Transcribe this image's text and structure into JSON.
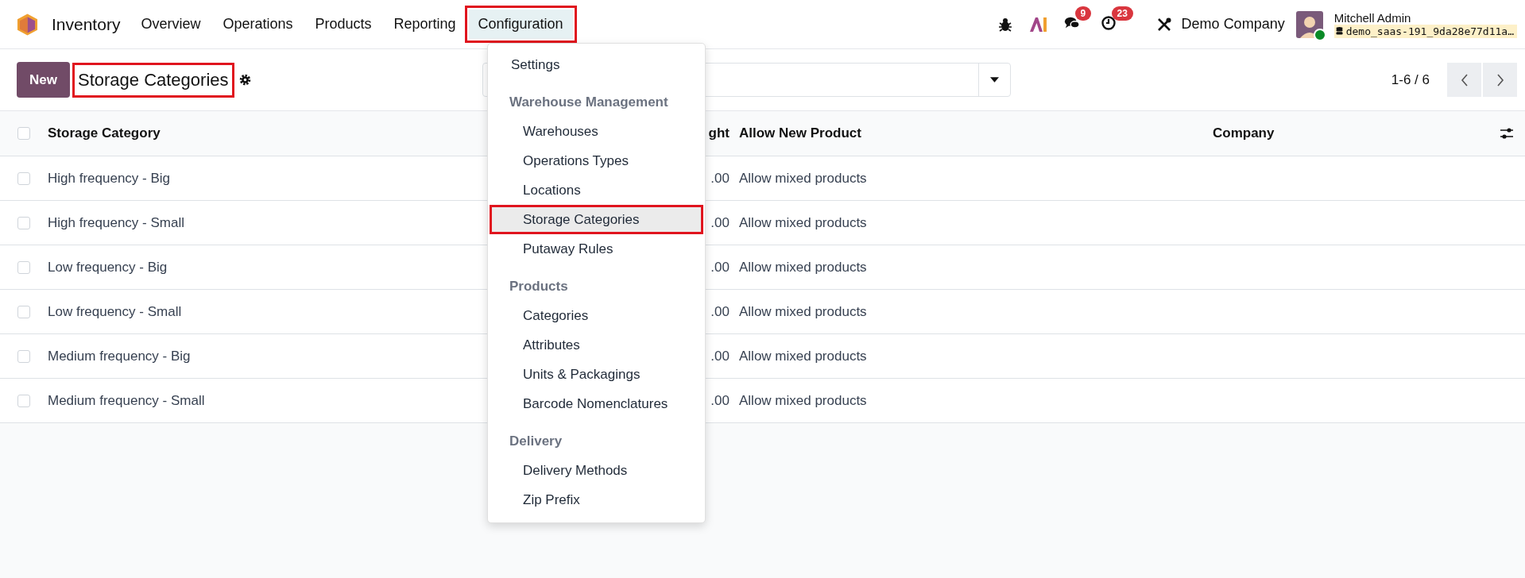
{
  "navbar": {
    "app_name": "Inventory",
    "menu": [
      {
        "label": "Overview",
        "selected": false,
        "highlighted": false
      },
      {
        "label": "Operations",
        "selected": false,
        "highlighted": false
      },
      {
        "label": "Products",
        "selected": false,
        "highlighted": false
      },
      {
        "label": "Reporting",
        "selected": false,
        "highlighted": false
      },
      {
        "label": "Configuration",
        "selected": true,
        "highlighted": true
      }
    ],
    "messages_badge": "9",
    "activities_badge": "23",
    "company": "Demo Company",
    "user": {
      "name": "Mitchell Admin",
      "database": "demo_saas-191_9da28e77d11a…",
      "online": true
    }
  },
  "control_panel": {
    "new_button": "New",
    "title": "Storage Categories",
    "title_highlighted": true,
    "pager": "1-6 / 6"
  },
  "table": {
    "header_checked": false,
    "columns": [
      "Storage Category",
      "ght",
      "Allow New Product",
      "Company"
    ],
    "rows": [
      {
        "checked": false,
        "name": "High frequency - Big",
        "column_2": ".00",
        "allow": "Allow mixed products"
      },
      {
        "checked": false,
        "name": "High frequency - Small",
        "column_2": ".00",
        "allow": "Allow mixed products"
      },
      {
        "checked": false,
        "name": "Low frequency - Big",
        "column_2": ".00",
        "allow": "Allow mixed products"
      },
      {
        "checked": false,
        "name": "Low frequency - Small",
        "column_2": ".00",
        "allow": "Allow mixed products"
      },
      {
        "checked": false,
        "name": "Medium frequency - Big",
        "column_2": ".00",
        "allow": "Allow mixed products"
      },
      {
        "checked": false,
        "name": "Medium frequency - Small",
        "column_2": ".00",
        "allow": "Allow mixed products"
      }
    ]
  },
  "dropdown": {
    "items": [
      {
        "kind": "item",
        "label": "Settings",
        "selected": false,
        "highlighted": false
      },
      {
        "kind": "header",
        "label": "Warehouse Management"
      },
      {
        "kind": "subitem",
        "label": "Warehouses",
        "selected": false,
        "highlighted": false
      },
      {
        "kind": "subitem",
        "label": "Operations Types",
        "selected": false,
        "highlighted": false
      },
      {
        "kind": "subitem",
        "label": "Locations",
        "selected": false,
        "highlighted": false
      },
      {
        "kind": "subitem",
        "label": "Storage Categories",
        "selected": true,
        "highlighted": true
      },
      {
        "kind": "subitem",
        "label": "Putaway Rules",
        "selected": false,
        "highlighted": false
      },
      {
        "kind": "header",
        "label": "Products"
      },
      {
        "kind": "subitem",
        "label": "Categories",
        "selected": false,
        "highlighted": false
      },
      {
        "kind": "subitem",
        "label": "Attributes",
        "selected": false,
        "highlighted": false
      },
      {
        "kind": "subitem",
        "label": "Units & Packagings",
        "selected": false,
        "highlighted": false
      },
      {
        "kind": "subitem",
        "label": "Barcode Nomenclatures",
        "selected": false,
        "highlighted": false
      },
      {
        "kind": "header",
        "label": "Delivery"
      },
      {
        "kind": "subitem",
        "label": "Delivery Methods",
        "selected": false,
        "highlighted": false
      },
      {
        "kind": "subitem",
        "label": "Zip Prefix",
        "selected": false,
        "highlighted": false
      }
    ]
  }
}
